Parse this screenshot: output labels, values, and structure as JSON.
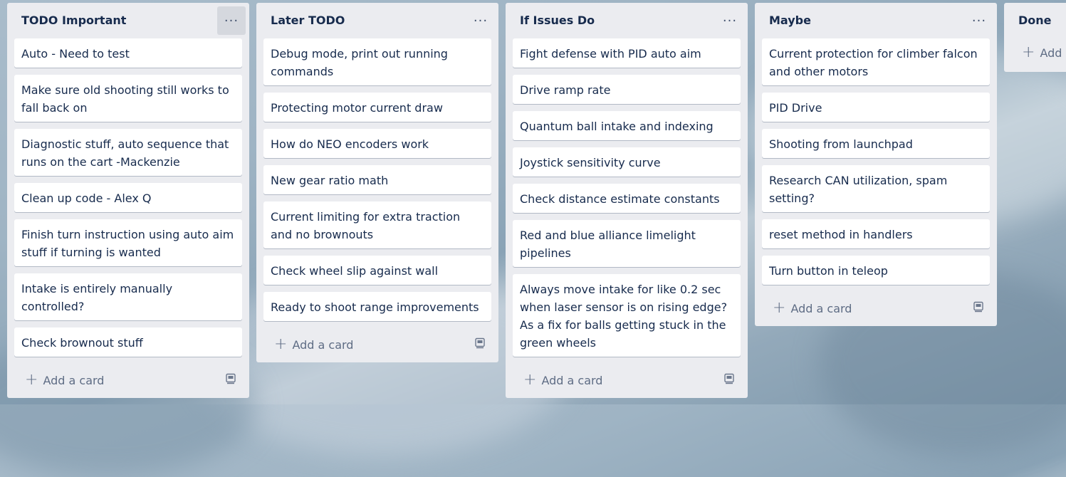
{
  "lists": [
    {
      "title": "TODO Important",
      "cards": [
        "Auto - Need to test",
        "Make sure old shooting still works to fall back on",
        "Diagnostic stuff, auto sequence that runs on the cart -Mackenzie",
        "Clean up code - Alex Q",
        "Finish turn instruction using auto aim stuff if turning is wanted",
        "Intake is entirely manually controlled?",
        "Check brownout stuff"
      ],
      "add_label": "Add a card"
    },
    {
      "title": "Later TODO",
      "cards": [
        "Debug mode, print out running commands",
        "Protecting motor current draw",
        "How do NEO encoders work",
        "New gear ratio math",
        "Current limiting for extra traction and no brownouts",
        "Check wheel slip against wall",
        "Ready to shoot range improvements"
      ],
      "add_label": "Add a card"
    },
    {
      "title": "If Issues Do",
      "cards": [
        "Fight defense with PID auto aim",
        "Drive ramp rate",
        "Quantum ball intake and indexing",
        "Joystick sensitivity curve",
        "Check distance estimate constants",
        "Red and blue alliance limelight pipelines",
        "Always move intake for like 0.2 sec when laser sensor is on rising edge? As a fix for balls getting stuck in the green wheels"
      ],
      "add_label": "Add a card"
    },
    {
      "title": "Maybe",
      "cards": [
        "Current protection for climber falcon and other motors",
        "PID Drive",
        "Shooting from launchpad",
        "Research CAN utilization, spam setting?",
        "reset method in handlers",
        "Turn button in teleop"
      ],
      "add_label": "Add a card"
    },
    {
      "title": "Done",
      "cards": [],
      "add_label": "Add a"
    }
  ],
  "menu_icon": "ellipsis-icon",
  "template_icon": "card-template-icon",
  "colors": {
    "list_bg": "#ebecf0",
    "card_bg": "#ffffff",
    "title_text": "#172b4d",
    "muted_text": "#5e6c84"
  }
}
